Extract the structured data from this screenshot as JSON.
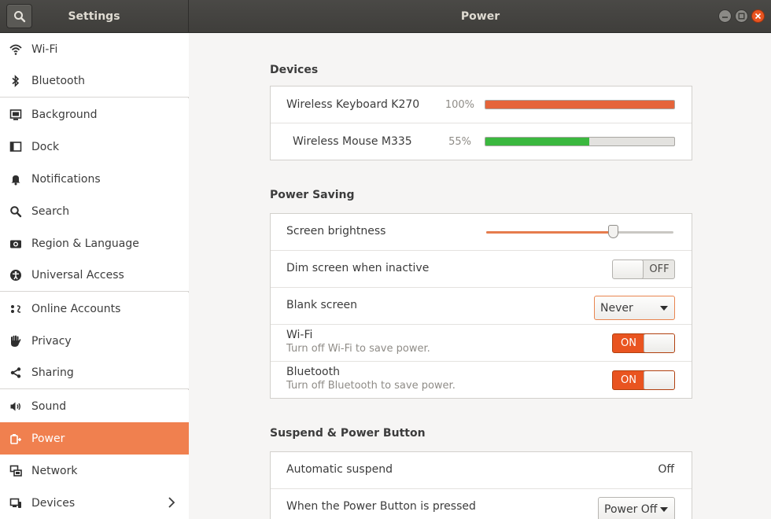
{
  "header": {
    "sidebar_title": "Settings",
    "panel_title": "Power"
  },
  "sidebar": {
    "items": [
      {
        "label": "Wi-Fi",
        "icon": "wifi-icon"
      },
      {
        "label": "Bluetooth",
        "icon": "bluetooth-icon"
      },
      {
        "label": "Background",
        "icon": "background-icon"
      },
      {
        "label": "Dock",
        "icon": "dock-icon"
      },
      {
        "label": "Notifications",
        "icon": "bell-icon"
      },
      {
        "label": "Search",
        "icon": "search-icon"
      },
      {
        "label": "Region & Language",
        "icon": "camera-icon"
      },
      {
        "label": "Universal Access",
        "icon": "accessibility-icon"
      },
      {
        "label": "Online Accounts",
        "icon": "cloud-accounts-icon"
      },
      {
        "label": "Privacy",
        "icon": "hand-icon"
      },
      {
        "label": "Sharing",
        "icon": "share-icon"
      },
      {
        "label": "Sound",
        "icon": "speaker-icon"
      },
      {
        "label": "Power",
        "icon": "power-plug-icon",
        "active": true
      },
      {
        "label": "Network",
        "icon": "network-icon"
      },
      {
        "label": "Devices",
        "icon": "devices-icon"
      }
    ]
  },
  "devices": {
    "title": "Devices",
    "items": [
      {
        "name": "Wireless Keyboard K270",
        "percent_label": "100%",
        "level": 1.0,
        "color": "#e5643a"
      },
      {
        "name": "Wireless Mouse M335",
        "percent_label": "55%",
        "level": 0.55,
        "color": "#3bb83f"
      }
    ]
  },
  "power_saving": {
    "title": "Power Saving",
    "brightness": {
      "label": "Screen brightness",
      "level": 0.68
    },
    "dim": {
      "label": "Dim screen when inactive",
      "state": "OFF"
    },
    "blank": {
      "label": "Blank screen",
      "value": "Never"
    },
    "wifi": {
      "label": "Wi-Fi",
      "sublabel": "Turn off Wi-Fi to save power.",
      "state": "ON"
    },
    "bluetooth": {
      "label": "Bluetooth",
      "sublabel": "Turn off Bluetooth to save power.",
      "state": "ON"
    }
  },
  "suspend": {
    "title": "Suspend & Power Button",
    "auto": {
      "label": "Automatic suspend",
      "value": "Off"
    },
    "button": {
      "label": "When the Power Button is pressed",
      "value": "Power Off"
    }
  },
  "colors": {
    "accent": "#e95420",
    "sidebar_active": "#f0804f"
  }
}
